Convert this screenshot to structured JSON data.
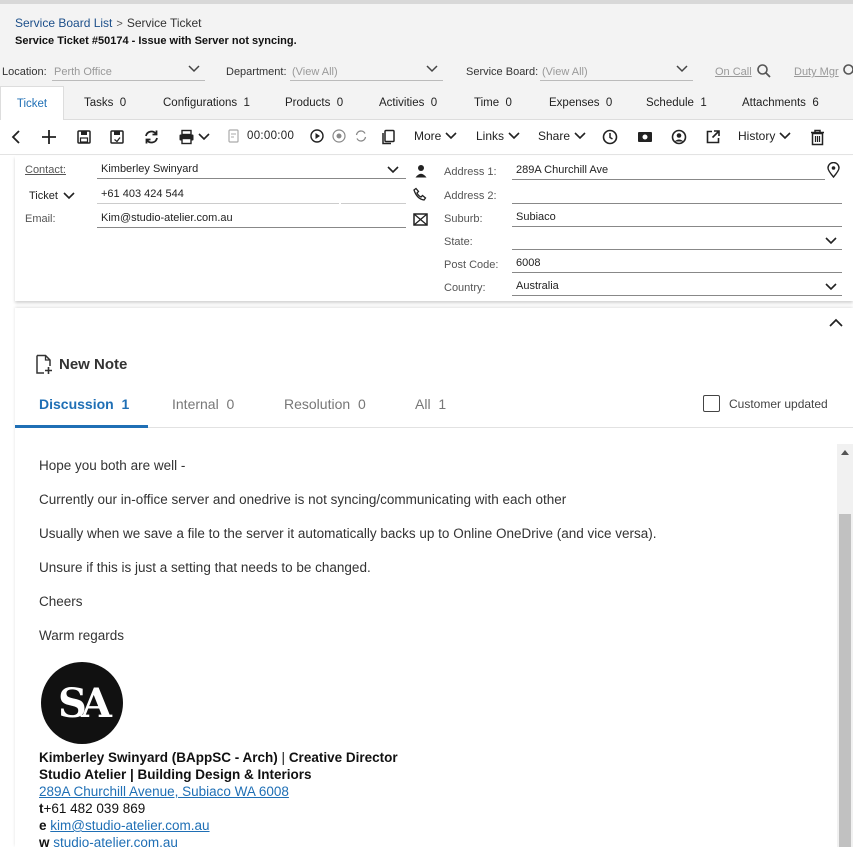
{
  "breadcrumb": {
    "list": "Service Board List",
    "current": "Service Ticket"
  },
  "ticket_title": "Service Ticket #50174 - Issue with Server not syncing.",
  "filters": {
    "location_label": "Location:",
    "location_value": "Perth Office",
    "department_label": "Department:",
    "department_value": "(View All)",
    "board_label": "Service Board:",
    "board_value": "(View All)",
    "on_call": "On Call",
    "duty_mgr": "Duty Mgr"
  },
  "tabs": [
    {
      "label": "Ticket",
      "count": ""
    },
    {
      "label": "Tasks",
      "count": "0"
    },
    {
      "label": "Configurations",
      "count": "1"
    },
    {
      "label": "Products",
      "count": "0"
    },
    {
      "label": "Activities",
      "count": "0"
    },
    {
      "label": "Time",
      "count": "0"
    },
    {
      "label": "Expenses",
      "count": "0"
    },
    {
      "label": "Schedule",
      "count": "1"
    },
    {
      "label": "Attachments",
      "count": "6"
    }
  ],
  "toolbar": {
    "timer": "00:00:00",
    "more": "More",
    "links": "Links",
    "share": "Share",
    "history": "History"
  },
  "contact": {
    "contact_label": "Contact:",
    "contact_value": "Kimberley Swinyard",
    "phone_type": "Ticket",
    "phone_value": "+61 403 424 544",
    "email_label": "Email:",
    "email_value": "Kim@studio-atelier.com.au",
    "address1_label": "Address 1:",
    "address1_value": "289A Churchill Ave",
    "address2_label": "Address 2:",
    "address2_value": "",
    "suburb_label": "Suburb:",
    "suburb_value": "Subiaco",
    "state_label": "State:",
    "state_value": "",
    "postcode_label": "Post Code:",
    "postcode_value": "6008",
    "country_label": "Country:",
    "country_value": "Australia"
  },
  "notes": {
    "new_note": "New Note",
    "tabs": [
      {
        "label": "Discussion",
        "count": "1"
      },
      {
        "label": "Internal",
        "count": "0"
      },
      {
        "label": "Resolution",
        "count": "0"
      },
      {
        "label": "All",
        "count": "1"
      }
    ],
    "customer_updated": "Customer updated",
    "lines": [
      "Hope you both are well -",
      "Currently our in-office server and onedrive is not syncing/communicating with each other",
      "Usually when we save a file to the server it automatically backs up to Online OneDrive (and vice versa).",
      "Unsure if this is just a setting that needs to be changed.",
      "Cheers",
      "Warm regards"
    ],
    "logo_text": "SA",
    "signature": {
      "name": "Kimberley Swinyard (BAppSC - Arch)",
      "role": "Creative Director",
      "company": "Studio Atelier | Building Design & Interiors",
      "address_link": "289A Churchill Avenue, Subiaco WA 6008",
      "phone_prefix": "t",
      "phone": "+61 482 039 869",
      "email_prefix": "e",
      "email": "kim@studio-atelier.com.au",
      "web_prefix": "w",
      "web": "studio-atelier.com.au"
    }
  },
  "colors": {
    "accent": "#1f6fb5",
    "link": "#1c4f8a",
    "header_bg": "#f3f3f3"
  }
}
